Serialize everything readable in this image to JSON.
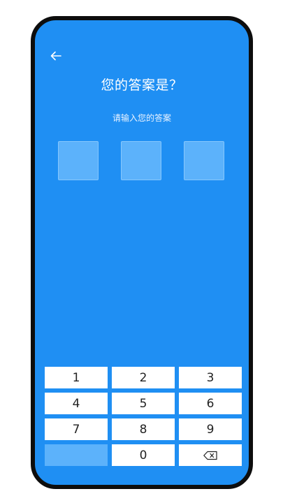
{
  "header": {
    "back_icon": "arrow-left-icon",
    "title": "您的答案是？",
    "subtitle": "请输入您的答案"
  },
  "answer_boxes": [
    {
      "value": ""
    },
    {
      "value": ""
    },
    {
      "value": ""
    }
  ],
  "keypad": {
    "keys": [
      "1",
      "2",
      "3",
      "4",
      "5",
      "6",
      "7",
      "8",
      "9",
      "",
      "0"
    ],
    "backspace_icon": "backspace-icon"
  },
  "colors": {
    "background": "#1f8ff3",
    "input_box": "#5cb2fb",
    "key": "#ffffff",
    "frame": "#0d0d0d"
  }
}
